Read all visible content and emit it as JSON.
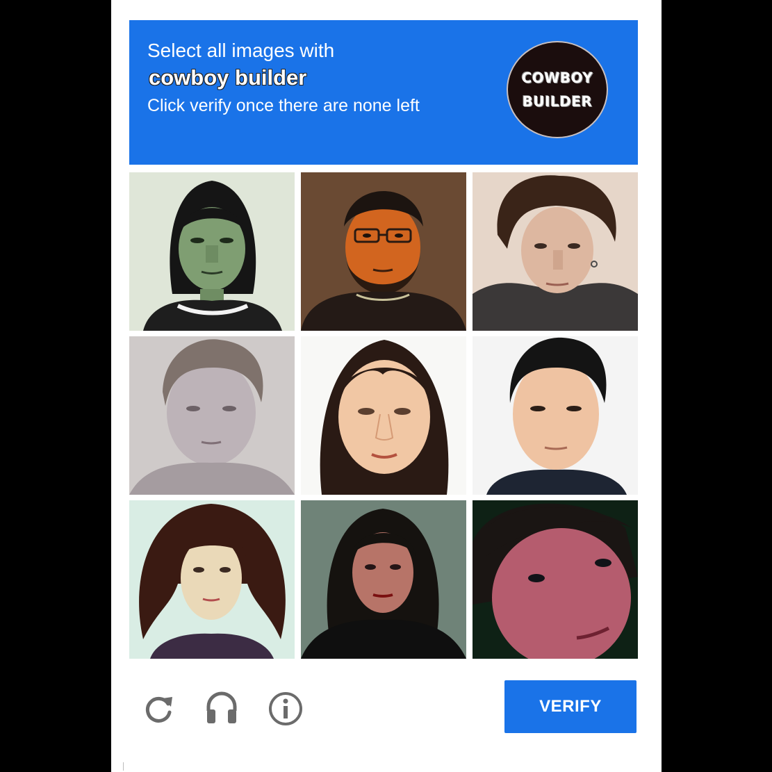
{
  "challenge": {
    "instruction": "Select all images with",
    "target": "cowboy builder",
    "subtext": "Click verify once there are none left",
    "badge_line1": "COWBOY",
    "badge_line2": "BUILDER"
  },
  "colors": {
    "accent": "#1a73e8",
    "background": "#000000",
    "card": "#ffffff",
    "icon": "#6b6b6b"
  },
  "tiles": [
    {
      "selected": false
    },
    {
      "selected": false
    },
    {
      "selected": false
    },
    {
      "selected": false
    },
    {
      "selected": false
    },
    {
      "selected": false
    },
    {
      "selected": false
    },
    {
      "selected": false
    },
    {
      "selected": false
    }
  ],
  "footer": {
    "reload_icon": "reload-icon",
    "audio_icon": "headphones-icon",
    "info_icon": "info-icon",
    "verify_label": "VERIFY"
  }
}
